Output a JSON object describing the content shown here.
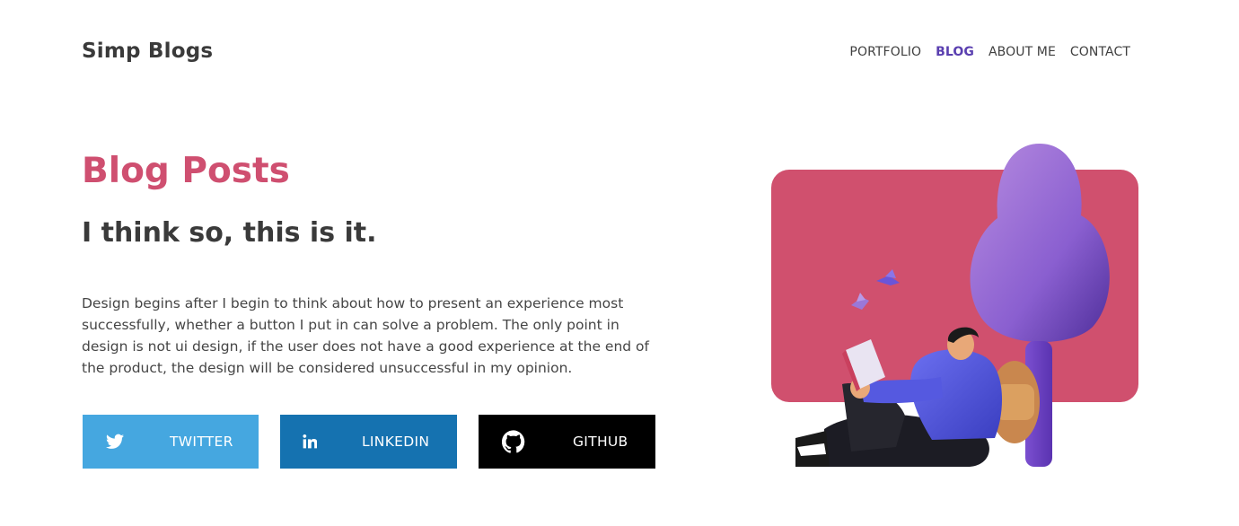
{
  "header": {
    "logo": "Simp Blogs",
    "nav": [
      {
        "label": "PORTFOLIO",
        "active": false
      },
      {
        "label": "BLOG",
        "active": true
      },
      {
        "label": "ABOUT ME",
        "active": false
      },
      {
        "label": "CONTACT",
        "active": false
      }
    ]
  },
  "hero": {
    "title": "Blog Posts",
    "subtitle": "I think so, this is it.",
    "body": "Design begins after I begin to think about how to present an experience most successfully, whether a button I put in can solve a problem. The only point in design is not ui design, if the user does not have a good experience at the end of the product, the design will be considered unsuccessful in my opinion."
  },
  "social": [
    {
      "label": "TWITTER",
      "icon": "twitter-icon",
      "color": "#45a7e0"
    },
    {
      "label": "LINKEDIN",
      "icon": "linkedin-icon",
      "color": "#1572b0"
    },
    {
      "label": "GITHUB",
      "icon": "github-icon",
      "color": "#000000"
    }
  ],
  "colors": {
    "accent": "#cf4f70",
    "nav_active": "#5a3fb0",
    "illustration_bg": "#d0506e",
    "tree": "#8a5fd0"
  }
}
